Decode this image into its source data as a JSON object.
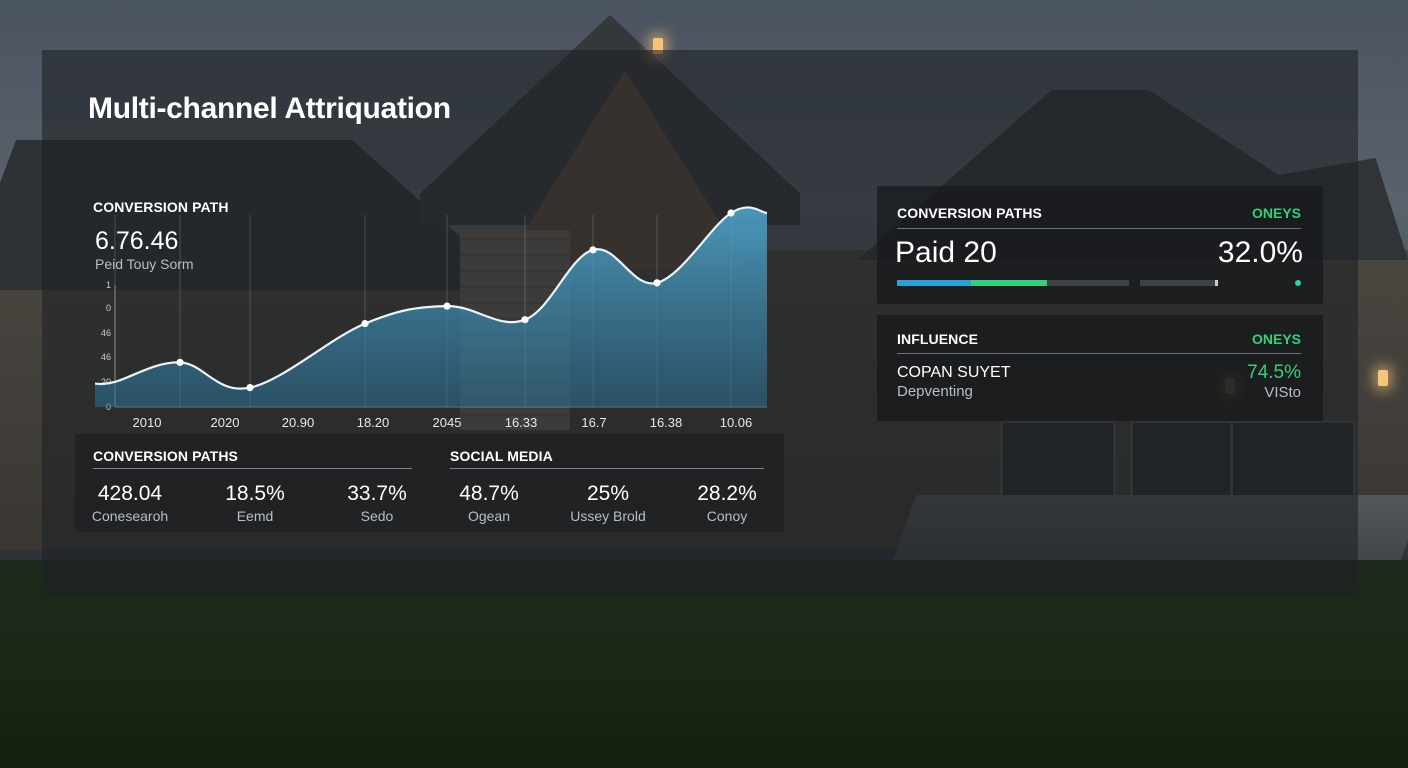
{
  "title": "Multi-channel Attriquation",
  "colors": {
    "accent_blue": "#2b9fd8",
    "accent_green": "#33d17a",
    "area_fill": "#3f8fb5",
    "line": "#eaf4fb"
  },
  "chart": {
    "header": "CONVERSION PATH",
    "big_value": "6.76.46",
    "subtitle": "Peid Touy Sorm",
    "y_ticks": [
      "1",
      "0",
      "46",
      "46",
      "20",
      "0"
    ],
    "x_ticks": [
      "2010",
      "2020",
      "20.90",
      "18.20",
      "2045",
      "16.33",
      "16.7",
      "16.38",
      "10.06"
    ]
  },
  "chart_data": {
    "type": "area",
    "title": "CONVERSION PATH",
    "x": [
      "2010",
      "2020",
      "20.90",
      "18.20",
      "2045",
      "16.33",
      "16.7",
      "16.38",
      "10.06"
    ],
    "series": [
      {
        "values": [
          0.13,
          0.23,
          0.1,
          0.43,
          0.52,
          0.45,
          0.81,
          0.64,
          1.0
        ]
      }
    ],
    "xlabel": "",
    "ylabel": "",
    "ylim": [
      0,
      1
    ],
    "grid": true,
    "legend": "none"
  },
  "left_panel": {
    "header": "CONVERSION PATHS",
    "stats": [
      {
        "value": "428.04",
        "label": "Conesearoh"
      },
      {
        "value": "18.5%",
        "label": "Eemd"
      },
      {
        "value": "33.7%",
        "label": "Sedo"
      }
    ]
  },
  "right_panel_bottom": {
    "header": "SOCIAL MEDIA",
    "stats": [
      {
        "value": "48.7%",
        "label": "Ogean"
      },
      {
        "value": "25%",
        "label": "Ussey Brold"
      },
      {
        "value": "28.2%",
        "label": "Conoy"
      }
    ]
  },
  "conv_card": {
    "header": "CONVERSION PATHS",
    "tag": "ONEYS",
    "left_value": "Paid 20",
    "right_value": "32.0%"
  },
  "influence_card": {
    "header": "INFLUENCE",
    "tag": "ONEYS",
    "row_label": "COPAN SUYET",
    "row_sub": "Depventing",
    "row_value": "74.5%",
    "row_value_sub": "VISto"
  }
}
